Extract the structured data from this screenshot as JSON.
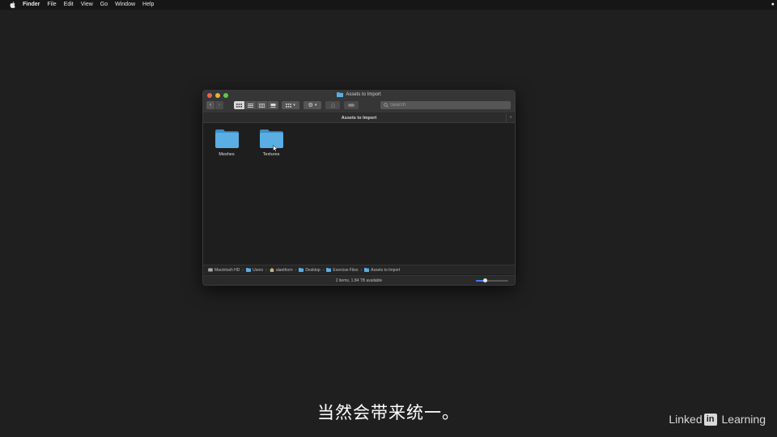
{
  "menubar": {
    "app_name": "Finder",
    "items": [
      "File",
      "Edit",
      "View",
      "Go",
      "Window",
      "Help"
    ]
  },
  "window": {
    "title": "Assets to Import",
    "path_header": "Assets to Import",
    "search_placeholder": "Search",
    "folders": [
      {
        "name": "Meshes",
        "icon": "folder-icon"
      },
      {
        "name": "Textures",
        "icon": "folder-icon"
      }
    ],
    "path_bar": [
      "Macintosh HD",
      "Users",
      "alanthorn",
      "Desktop",
      "Exercise Files",
      "Assets to Import"
    ],
    "status": "2 items, 1.84 TB available",
    "icon_size_slider": 0.25
  },
  "subtitle": "当然会带来统一。",
  "brand": {
    "pre": "Linked",
    "box": "in",
    "post": " Learning"
  },
  "colors": {
    "folder": "#5aaee3",
    "close": "#ec5f57",
    "minimize": "#e0b53b",
    "maximize": "#5fc74a",
    "accent": "#3b82f6"
  }
}
